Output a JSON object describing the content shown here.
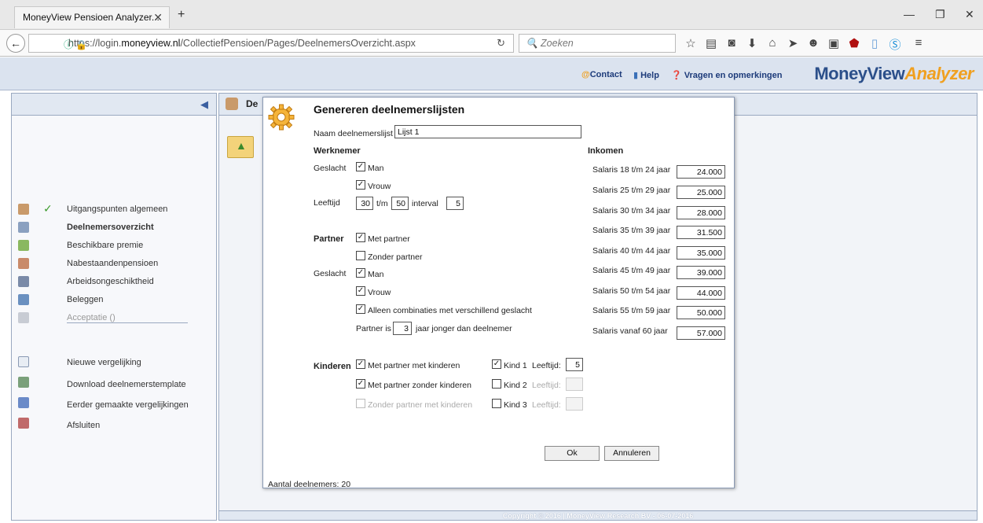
{
  "browser": {
    "tab_title": "MoneyView Pensioen Analyzer...",
    "url_prefix": "https://login.",
    "url_host": "moneyview.nl",
    "url_path": "/CollectiefPensioen/Pages/DeelnemersOverzicht.aspx",
    "search_placeholder": "Zoeken"
  },
  "header": {
    "contact": "Contact",
    "help": "Help",
    "feedback": "Vragen en opmerkingen",
    "brand_main": "MoneyView",
    "brand_sub": "Analyzer"
  },
  "sidebar": {
    "items": [
      {
        "label": "Uitgangspunten algemeen"
      },
      {
        "label": "Deelnemersoverzicht"
      },
      {
        "label": "Beschikbare premie"
      },
      {
        "label": "Nabestaandenpensioen"
      },
      {
        "label": "Arbeidsongeschiktheid"
      },
      {
        "label": "Beleggen"
      },
      {
        "label": "Acceptatie ()"
      }
    ],
    "actions": [
      {
        "label": "Nieuwe vergelijking"
      },
      {
        "label": "Download deelnemerstemplate"
      },
      {
        "label": "Eerder gemaakte vergelijkingen"
      },
      {
        "label": "Afsluiten"
      }
    ]
  },
  "main": {
    "header_title": "De",
    "footer": "Copyright © 2016 | MoneyView Research BV - 06-07-2016"
  },
  "modal": {
    "title": "Genereren deelnemerslijsten",
    "name_label": "Naam deelnemerslijst",
    "name_value": "Lijst 1",
    "werknemer_heading": "Werknemer",
    "geslacht_label": "Geslacht",
    "man_label": "Man",
    "vrouw_label": "Vrouw",
    "leeftijd_label": "Leeftijd",
    "age_from": "30",
    "tm_label": "t/m",
    "age_to": "50",
    "interval_label": "interval",
    "interval_value": "5",
    "partner_heading": "Partner",
    "met_partner": "Met partner",
    "zonder_partner": "Zonder partner",
    "partner_geslacht_label": "Geslacht",
    "partner_man": "Man",
    "partner_vrouw": "Vrouw",
    "combinaties": "Alleen combinaties met verschillend geslacht",
    "partner_is": "Partner is",
    "partner_years": "3",
    "jonger": "jaar jonger dan deelnemer",
    "kinderen_heading": "Kinderen",
    "met_partner_met_kinderen": "Met partner met kinderen",
    "met_partner_zonder_kinderen": "Met partner zonder kinderen",
    "zonder_partner_met_kinderen": "Zonder partner met kinderen",
    "kind1": "Kind 1",
    "kind2": "Kind 2",
    "kind3": "Kind 3",
    "leeftijd_colon": "Leeftijd:",
    "kind1_age": "5",
    "inkomen_heading": "Inkomen",
    "salaries": [
      {
        "label": "Salaris 18 t/m 24 jaar",
        "value": "24.000"
      },
      {
        "label": "Salaris 25 t/m 29 jaar",
        "value": "25.000"
      },
      {
        "label": "Salaris 30 t/m 34 jaar",
        "value": "28.000"
      },
      {
        "label": "Salaris 35 t/m 39 jaar",
        "value": "31.500"
      },
      {
        "label": "Salaris 40 t/m 44 jaar",
        "value": "35.000"
      },
      {
        "label": "Salaris 45 t/m 49 jaar",
        "value": "39.000"
      },
      {
        "label": "Salaris 50 t/m 54 jaar",
        "value": "44.000"
      },
      {
        "label": "Salaris 55 t/m 59 jaar",
        "value": "50.000"
      },
      {
        "label": "Salaris vanaf 60 jaar",
        "value": "57.000"
      }
    ],
    "ok_label": "Ok",
    "cancel_label": "Annuleren",
    "count_label": "Aantal deelnemers: 20"
  }
}
